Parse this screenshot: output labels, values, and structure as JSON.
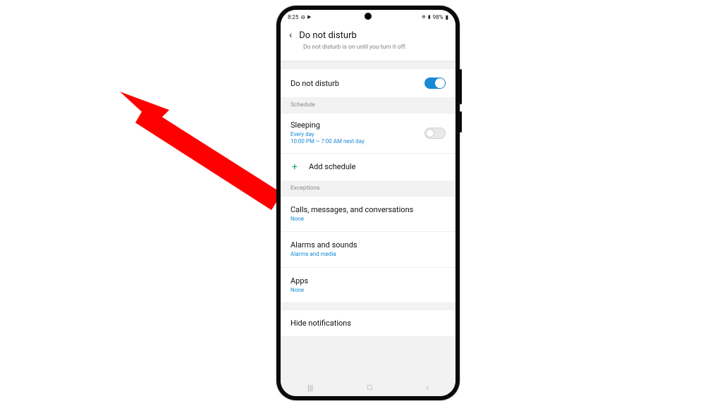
{
  "status": {
    "time": "8:25",
    "battery": "98%"
  },
  "header": {
    "title": "Do not disturb",
    "subtitle": "Do not disturb is on until you turn it off."
  },
  "dnd": {
    "label": "Do not disturb"
  },
  "sections": {
    "schedule": "Schedule",
    "exceptions": "Exceptions"
  },
  "schedule": {
    "sleeping": {
      "label": "Sleeping",
      "days": "Every day",
      "time": "10:00 PM ~ 7:00 AM next day"
    },
    "add": "Add schedule"
  },
  "exceptions": {
    "calls": {
      "label": "Calls, messages, and conversations",
      "sub": "None"
    },
    "alarms": {
      "label": "Alarms and sounds",
      "sub": "Alarms and media"
    },
    "apps": {
      "label": "Apps",
      "sub": "None"
    }
  },
  "hide": {
    "label": "Hide notifications"
  }
}
